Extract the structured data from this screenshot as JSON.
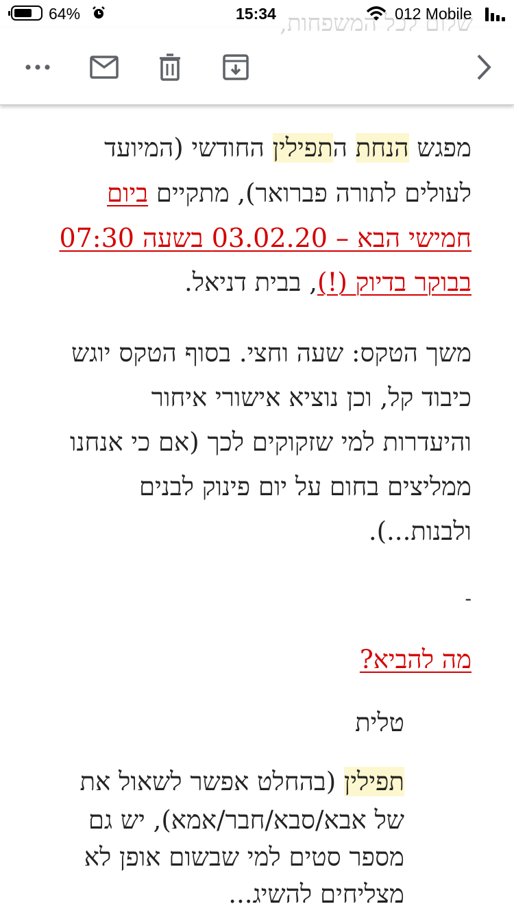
{
  "status_bar": {
    "battery_percent": "64%",
    "time": "15:34",
    "carrier": "012 Mobile",
    "behind_text": "שלום לכל המשפחות,"
  },
  "toolbar": {
    "icons": [
      "more-icon",
      "mail-icon",
      "delete-icon",
      "archive-icon",
      "chevron-right-icon"
    ]
  },
  "body": {
    "p1_l1_a": "מפגש ",
    "p1_l1_b": "הנחת",
    "p1_l1_c": " ה",
    "p1_l1_d": "תפילין",
    "p1_l1_e": " החודשי (המיועד",
    "p1_l2_a": "לעולים לתורה פברואר), מתקיים ",
    "p1_l2_b": "ביום",
    "p1_l3": "חמישי הבא – 03.02.20  בשעה 07:30",
    "p1_l4_a": " בבוקר בדיוק (!)",
    "p1_l4_b": ", בבית דניאל.",
    "p2_l1": "משך הטקס: שעה וחצי. בסוף הטקס יוגש",
    "p2_l2": "כיבוד קל, וכן נוציא אישורי איחור",
    "p2_l3": "והיעדרות למי שזקוקים לכך (אם כי אנחנו",
    "p2_l4": "ממליצים בחום על יום פינוק לבנים",
    "p2_l5": "ולבנות...).",
    "dash": "-",
    "what_to_bring": "מה להביא?",
    "bullet_mark": "·",
    "item1": "טלית",
    "item2_l1_a": "תפילין",
    "item2_l1_b": " (בהחלט אפשר לשאול את",
    "item2_l2": "של אבא/סבא/חבר/אמא), יש גם",
    "item2_l3": "מספר סטים למי שבשום אופן לא",
    "item2_l4": "מצליחים להשיג..."
  },
  "colors": {
    "red": "#d40000",
    "highlight": "#fdf7cf",
    "icon_gray": "#5f6368"
  }
}
